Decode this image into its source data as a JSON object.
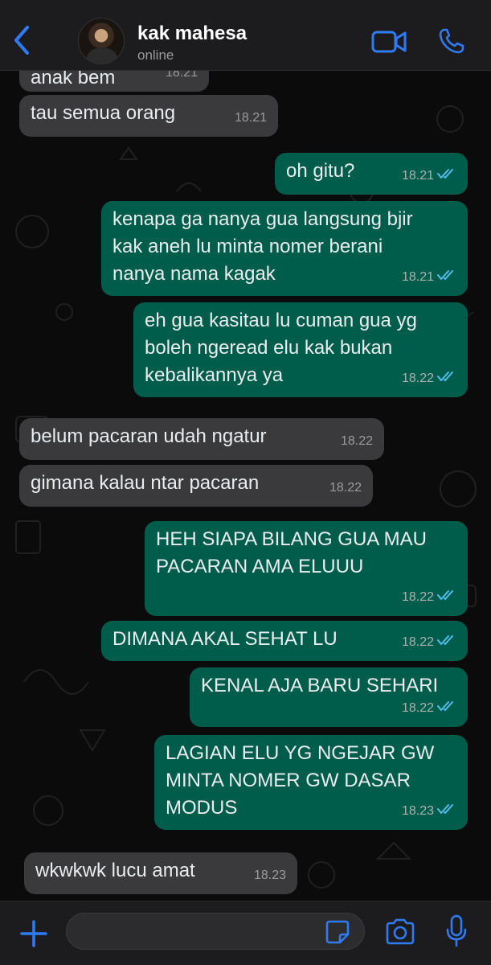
{
  "header": {
    "contact_name": "kak mahesa",
    "status": "online"
  },
  "colors": {
    "accent": "#2f7bf6",
    "incoming_bubble": "#3a3a3c",
    "outgoing_bubble": "#005c4b",
    "header_bg": "#1c1c1e",
    "read_ticks": "#53bdeb"
  },
  "messages": [
    {
      "direction": "in",
      "text": "anak bem",
      "time": "18.21"
    },
    {
      "direction": "in",
      "text": "tau semua orang",
      "time": "18.21"
    },
    {
      "direction": "out",
      "text": "oh gitu?",
      "time": "18.21",
      "status": "read"
    },
    {
      "direction": "out",
      "text": "kenapa ga nanya gua langsung bjir\nkak aneh lu minta nomer berani\nnanya nama kagak",
      "time": "18.21",
      "status": "read"
    },
    {
      "direction": "out",
      "text": "eh gua kasitau lu cuman gua yg\nboleh ngeread elu kak bukan\nkebalikannya ya",
      "time": "18.22",
      "status": "read"
    },
    {
      "direction": "in",
      "text": "belum pacaran udah ngatur",
      "time": "18.22"
    },
    {
      "direction": "in",
      "text": "gimana kalau ntar pacaran",
      "time": "18.22"
    },
    {
      "direction": "out",
      "text": "HEH SIAPA BILANG GUA MAU\nPACARAN AMA ELUUU",
      "time": "18.22",
      "status": "read"
    },
    {
      "direction": "out",
      "text": "DIMANA AKAL SEHAT LU",
      "time": "18.22",
      "status": "read"
    },
    {
      "direction": "out",
      "text": "KENAL AJA BARU SEHARI",
      "time": "18.22",
      "status": "read"
    },
    {
      "direction": "out",
      "text": "LAGIAN ELU YG NGEJAR GW\nMINTA NOMER GW DASAR\nMODUS",
      "time": "18.23",
      "status": "read"
    },
    {
      "direction": "in",
      "text": "wkwkwk lucu amat",
      "time": "18.23"
    }
  ],
  "icons": {
    "back": "chevron-left-icon",
    "video": "video-camera-icon",
    "phone": "phone-icon",
    "plus": "plus-icon",
    "sticker": "sticker-icon",
    "camera": "camera-icon",
    "mic": "microphone-icon",
    "read_receipt": "double-check-icon"
  }
}
